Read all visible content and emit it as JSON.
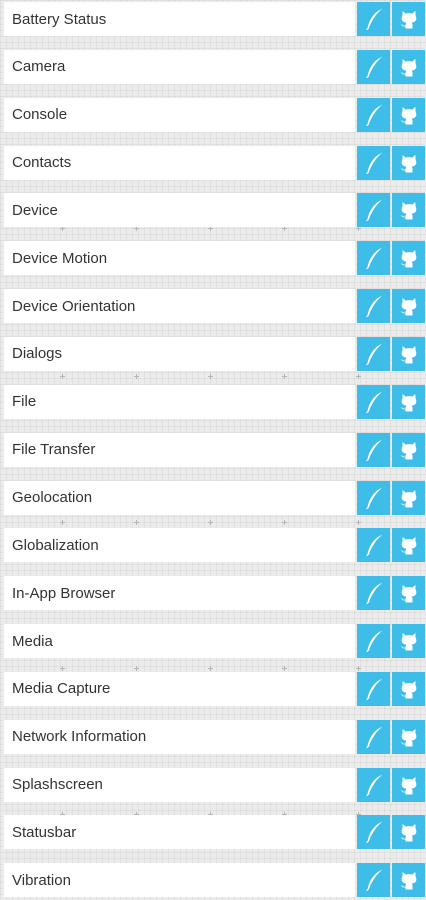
{
  "plugins": [
    {
      "name": "Battery Status"
    },
    {
      "name": "Camera"
    },
    {
      "name": "Console"
    },
    {
      "name": "Contacts"
    },
    {
      "name": "Device"
    },
    {
      "name": "Device Motion"
    },
    {
      "name": "Device Orientation"
    },
    {
      "name": "Dialogs"
    },
    {
      "name": "File"
    },
    {
      "name": "File Transfer"
    },
    {
      "name": "Geolocation"
    },
    {
      "name": "Globalization"
    },
    {
      "name": "In-App Browser"
    },
    {
      "name": "Media"
    },
    {
      "name": "Media Capture"
    },
    {
      "name": "Network Information"
    },
    {
      "name": "Splashscreen"
    },
    {
      "name": "Statusbar"
    },
    {
      "name": "Vibration"
    }
  ],
  "buttons": {
    "docs_icon": "feather-icon",
    "repo_icon": "github-octocat-icon"
  },
  "colors": {
    "button_bg": "#3ebde9",
    "row_bg": "#ffffff",
    "page_bg": "#ebebeb",
    "text": "#333333"
  }
}
